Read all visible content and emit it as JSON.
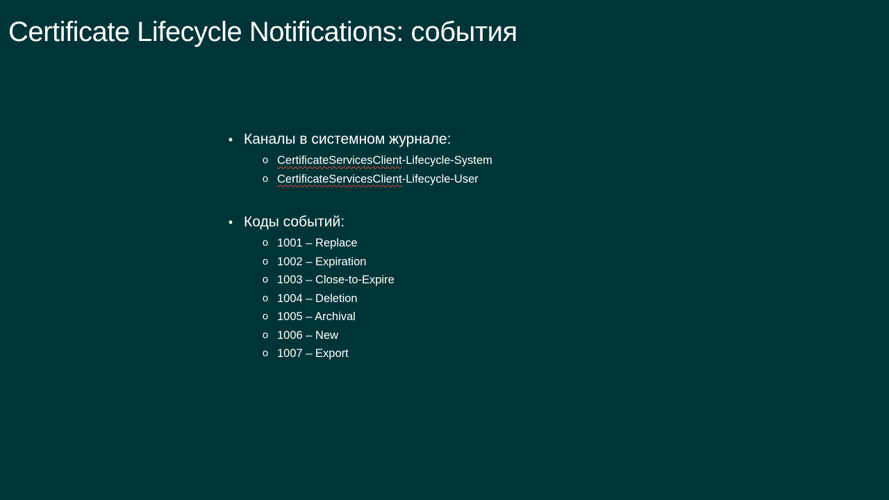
{
  "slide": {
    "title": "Certificate Lifecycle Notifications: события"
  },
  "sections": {
    "channels": {
      "heading": "Каналы в системном журнале:",
      "items": [
        {
          "prefix": "CertificateServicesClient",
          "suffix": "-Lifecycle-System"
        },
        {
          "prefix": "CertificateServicesClient",
          "suffix": "-Lifecycle-User"
        }
      ]
    },
    "event_codes": {
      "heading": "Коды событий:",
      "items": [
        "1001 – Replace",
        "1002 – Expiration",
        "1003 – Close-to-Expire",
        "1004 – Deletion",
        "1005 – Archival",
        "1006 – New",
        "1007 – Export"
      ]
    }
  },
  "markers": {
    "bullet": "•",
    "sub": "o"
  },
  "colors": {
    "background": "#003538",
    "text": "#ffffff",
    "spellcheck_underline": "#e0433e"
  }
}
